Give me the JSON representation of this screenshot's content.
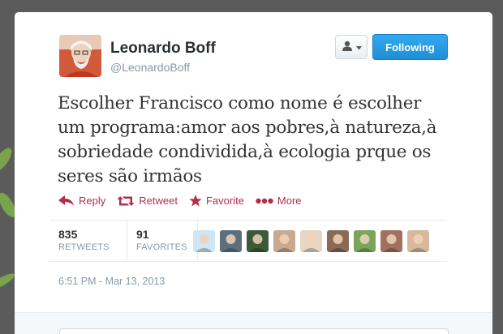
{
  "author": {
    "name": "Leonardo Boff",
    "handle": "@LeonardoBoff"
  },
  "buttons": {
    "follow_menu_icon": "user-dropdown-icon",
    "following": "Following"
  },
  "tweet": {
    "lines": [
      "Escolher Francisco como nome é escolher",
      "um programa:amor aos pobres,à natureza,à",
      "sobriedade condividida,à ecologia prque os",
      "seres são irmãos"
    ],
    "timestamp": "6:51 PM - Mar 13, 2013"
  },
  "actions": {
    "reply": "Reply",
    "retweet": "Retweet",
    "favorite": "Favorite",
    "more": "More"
  },
  "stats": {
    "retweets_count": "835",
    "retweets_label": "RETWEETS",
    "favorites_count": "91",
    "favorites_label": "FAVORITES"
  },
  "favoriters": [
    {
      "name": "favoriter-1",
      "color": "#cfe6f5"
    },
    {
      "name": "favoriter-2",
      "color": "#5c6f7d"
    },
    {
      "name": "favoriter-3",
      "color": "#3c5a3a"
    },
    {
      "name": "favoriter-4",
      "color": "#c9a98f"
    },
    {
      "name": "favoriter-5",
      "color": "#e7d6c6"
    },
    {
      "name": "favoriter-6",
      "color": "#8a6a55"
    },
    {
      "name": "favoriter-7",
      "color": "#7aa65a"
    },
    {
      "name": "favoriter-8",
      "color": "#a07060"
    },
    {
      "name": "favoriter-9",
      "color": "#d8b89b"
    }
  ],
  "colors": {
    "accent": "#1f8fd7",
    "action": "#b0304a",
    "background": "#5b5b5b"
  }
}
